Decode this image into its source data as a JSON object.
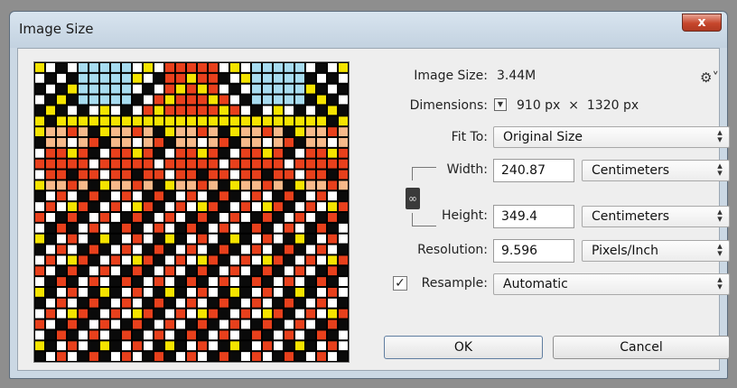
{
  "window": {
    "title": "Image Size",
    "close_symbol": "x"
  },
  "info": {
    "image_size_label": "Image Size:",
    "image_size_value": "3.44M",
    "dimensions_label": "Dimensions:",
    "dimensions_value": "910 px  ×  1320 px"
  },
  "fit_to": {
    "label": "Fit To:",
    "value": "Original Size"
  },
  "width": {
    "label": "Width:",
    "value": "240.87",
    "unit": "Centimeters"
  },
  "height": {
    "label": "Height:",
    "value": "349.4",
    "unit": "Centimeters"
  },
  "resolution": {
    "label": "Resolution:",
    "value": "9.596",
    "unit": "Pixels/Inch"
  },
  "resample": {
    "label": "Resample:",
    "checked": true,
    "value": "Automatic"
  },
  "buttons": {
    "ok": "OK",
    "cancel": "Cancel"
  },
  "icons": {
    "gear": "gear-icon",
    "link": "link-icon",
    "dimensions_menu": "chevron-down-icon",
    "select_arrows": "up-down-arrows-icon"
  },
  "preview_palette": {
    "black": "#0a0a0a",
    "white": "#ffffff",
    "red": "#e8401c",
    "orange": "#f7b98a",
    "yellow": "#f5e400",
    "blue": "#a8dcf0"
  }
}
